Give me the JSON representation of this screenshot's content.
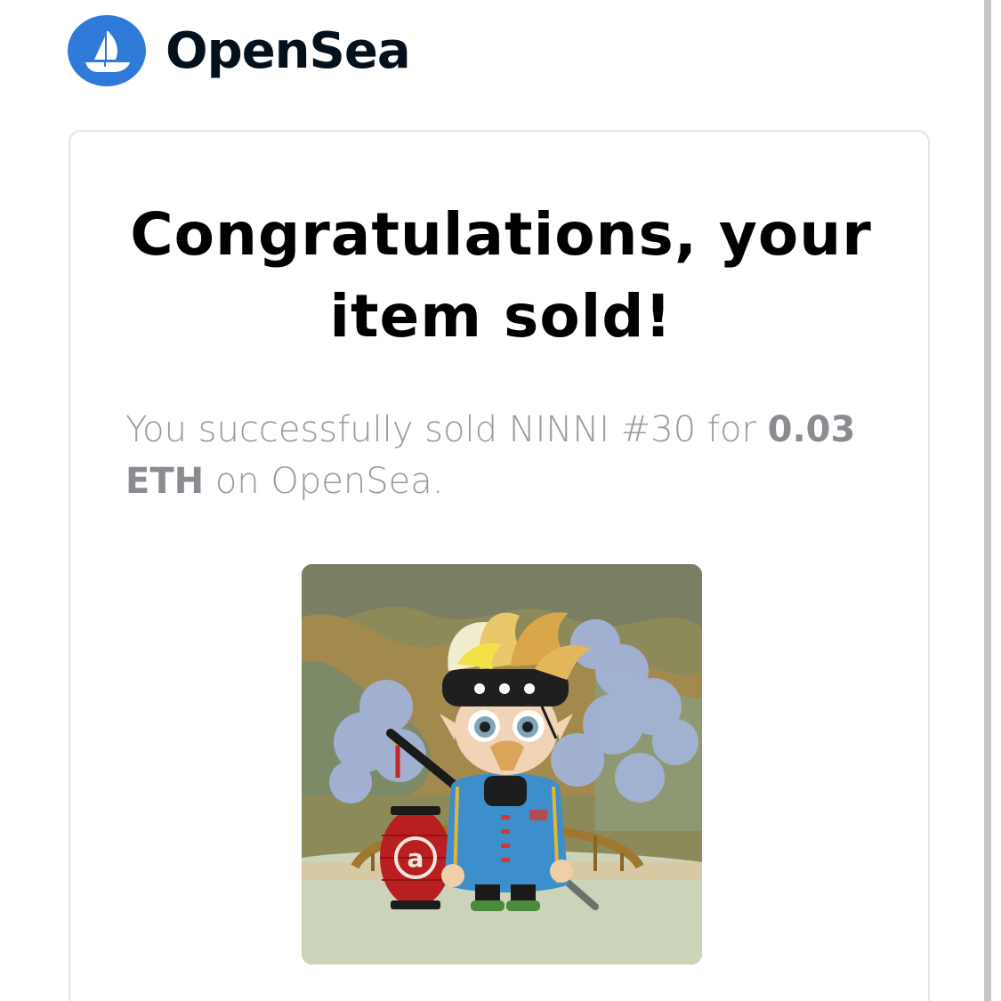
{
  "brand": {
    "name": "OpenSea",
    "logo_icon": "opensea-ship-icon",
    "logo_color": "#2f7ad9"
  },
  "email": {
    "headline_line1": "Congratulations, your",
    "headline_line2": "item sold!",
    "message_prefix": "You successfully sold NINNI #30 for",
    "price": "0.03 ETH",
    "message_suffix": "on OpenSea."
  },
  "item": {
    "name": "NINNI #30",
    "image_alt": "NINNI #30 3D character artwork",
    "lantern_text": "a"
  },
  "colors": {
    "text_dark": "#04111d",
    "text_muted": "#9a9aa0",
    "card_border": "#e4e4e7"
  }
}
